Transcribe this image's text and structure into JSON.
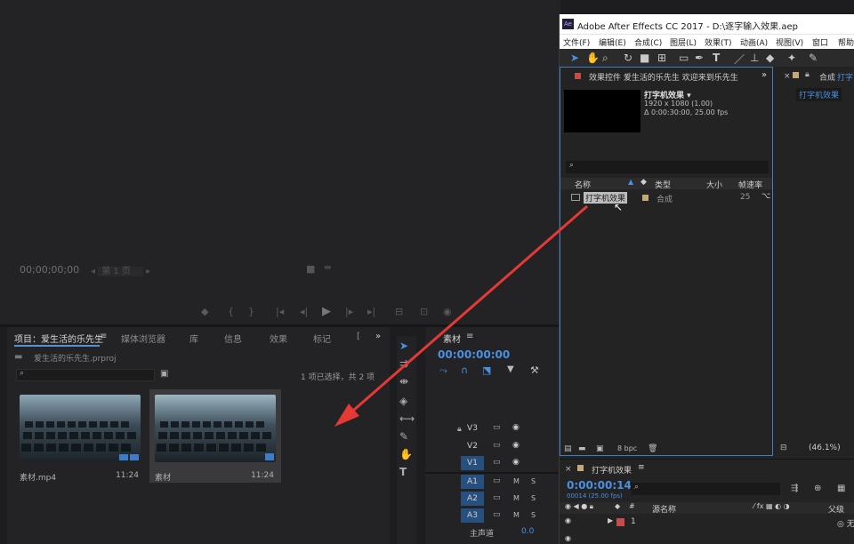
{
  "premiere": {
    "monitor": {
      "timecode": "00;00;00;00",
      "fit_label": "第 1 页"
    },
    "project_panel": {
      "tabs": [
        "项目：爱生活的乐先生",
        "媒体浏览器",
        "库",
        "信息",
        "效果",
        "标记",
        "["
      ],
      "project_file": "爱生活的乐先生.prproj",
      "selection_count": "1 项已选择，共 2 项",
      "items": [
        {
          "name": "素材.mp4",
          "duration": "11:24"
        },
        {
          "name": "素材",
          "duration": "11:24"
        }
      ]
    },
    "timeline": {
      "sequence_tab": "素材",
      "timecode": "00:00:00:00",
      "video_tracks": [
        "V3",
        "V2",
        "V1"
      ],
      "audio_tracks": [
        "A1",
        "A2",
        "A3"
      ],
      "master_label": "主声道",
      "master_value": "0.0",
      "m_label": "M",
      "s_label": "S"
    }
  },
  "after_effects": {
    "title": "Adobe After Effects CC 2017 - D:\\逐字输入效果.aep",
    "logo": "Ae",
    "menu": [
      "文件(F)",
      "编辑(E)",
      "合成(C)",
      "图层(L)",
      "效果(T)",
      "动画(A)",
      "视图(V)",
      "窗口",
      "帮助("
    ],
    "project_panel": {
      "header": "效果控件 爱生活的乐先生  欢迎来到乐先生",
      "comp_name": "打字机效果 ▾",
      "comp_res": "1920 x 1080 (1.00)",
      "comp_dur": "Δ 0:00:30:00, 25.00 fps",
      "columns": {
        "name": "名称",
        "type": "类型",
        "size": "大小",
        "fps": "帧速率"
      },
      "rows": [
        {
          "name": "打字机效果",
          "type": "合成",
          "fps": "25"
        }
      ],
      "bpc": "8 bpc"
    },
    "right_panel": {
      "tab": "合成",
      "tab_more": "打字",
      "comp_tab": "打字机效果",
      "zoom": "(46.1%)"
    },
    "timeline": {
      "tab": "打字机效果",
      "timecode": "0:00:00:14",
      "frames": "00014 (25.00 fps)",
      "source_name_col": "源名称",
      "parent_col": "父级",
      "layer_index": "1",
      "parent_value": "无"
    }
  },
  "colors": {
    "premiere_accent": "#4a90e2",
    "ae_border": "#3f7cc7",
    "arrow": "#e53935"
  }
}
